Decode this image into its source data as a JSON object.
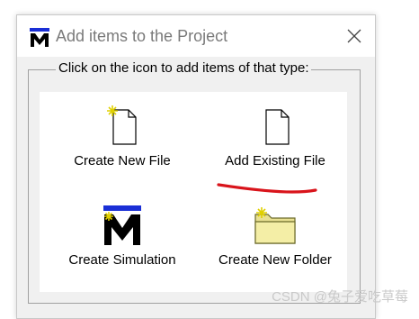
{
  "window": {
    "title": "Add items to the Project",
    "close_icon": "close-icon",
    "app_icon": "m-logo-icon"
  },
  "group": {
    "legend": "Click on the icon to add items of that type:"
  },
  "items": [
    {
      "label": "Create New File",
      "icon": "new-file-icon"
    },
    {
      "label": "Add Existing File",
      "icon": "file-icon"
    },
    {
      "label": "Create Simulation",
      "icon": "simulation-m-icon"
    },
    {
      "label": "Create New Folder",
      "icon": "new-folder-icon"
    }
  ],
  "annotation": {
    "color": "#d9141b"
  },
  "watermark": "CSDN @兔子爱吃草莓"
}
